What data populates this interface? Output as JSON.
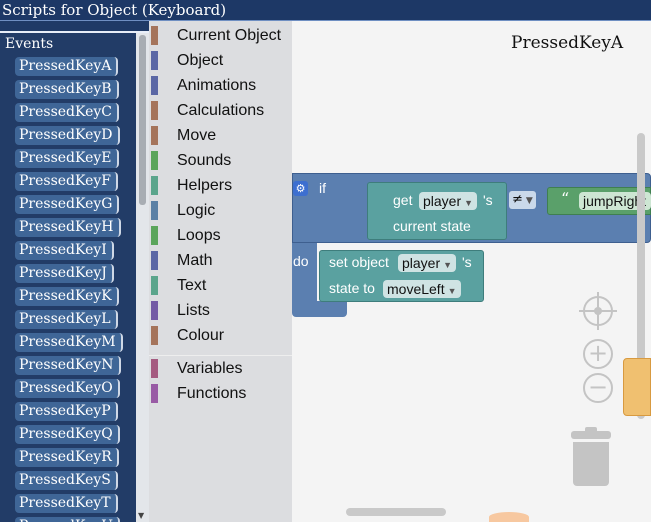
{
  "window": {
    "title": "Scripts for Object (Keyboard)"
  },
  "events": {
    "title": "Events",
    "items": [
      "PressedKeyA",
      "PressedKeyB",
      "PressedKeyC",
      "PressedKeyD",
      "PressedKeyE",
      "PressedKeyF",
      "PressedKeyG",
      "PressedKeyH",
      "PressedKeyI",
      "PressedKeyJ",
      "PressedKeyK",
      "PressedKeyL",
      "PressedKeyM",
      "PressedKeyN",
      "PressedKeyO",
      "PressedKeyP",
      "PressedKeyQ",
      "PressedKeyR",
      "PressedKeyS",
      "PressedKeyT",
      "PressedKeyU"
    ]
  },
  "toolbox": {
    "categories": [
      {
        "label": "Current Object",
        "color": "#a5745b"
      },
      {
        "label": "Object",
        "color": "#5b67a5"
      },
      {
        "label": "Animations",
        "color": "#5b67a5"
      },
      {
        "label": "Calculations",
        "color": "#a5745b"
      },
      {
        "label": "Move",
        "color": "#a5745b"
      },
      {
        "label": "Sounds",
        "color": "#5ba55b"
      },
      {
        "label": "Helpers",
        "color": "#5ba58c"
      },
      {
        "label": "Logic",
        "color": "#5b80a5"
      },
      {
        "label": "Loops",
        "color": "#5ba55b"
      },
      {
        "label": "Math",
        "color": "#5b67a5"
      },
      {
        "label": "Text",
        "color": "#5ba58c"
      },
      {
        "label": "Lists",
        "color": "#745ba5"
      },
      {
        "label": "Colour",
        "color": "#a5745b"
      }
    ],
    "extra_categories": [
      {
        "label": "Variables",
        "color": "#a55b80"
      },
      {
        "label": "Functions",
        "color": "#995ba5"
      }
    ]
  },
  "workspace": {
    "event_title": "PressedKeyA",
    "if_block": {
      "if_label": "if",
      "do_label": "do",
      "get_label": "get",
      "get_object": "player",
      "possessive": "'s",
      "property": "current state",
      "operator": "≠",
      "compare_value": "jumpRight"
    },
    "set_block": {
      "set_label": "set object",
      "object": "player",
      "possessive": "'s",
      "field_label": "state to",
      "value": "moveLeft"
    }
  }
}
